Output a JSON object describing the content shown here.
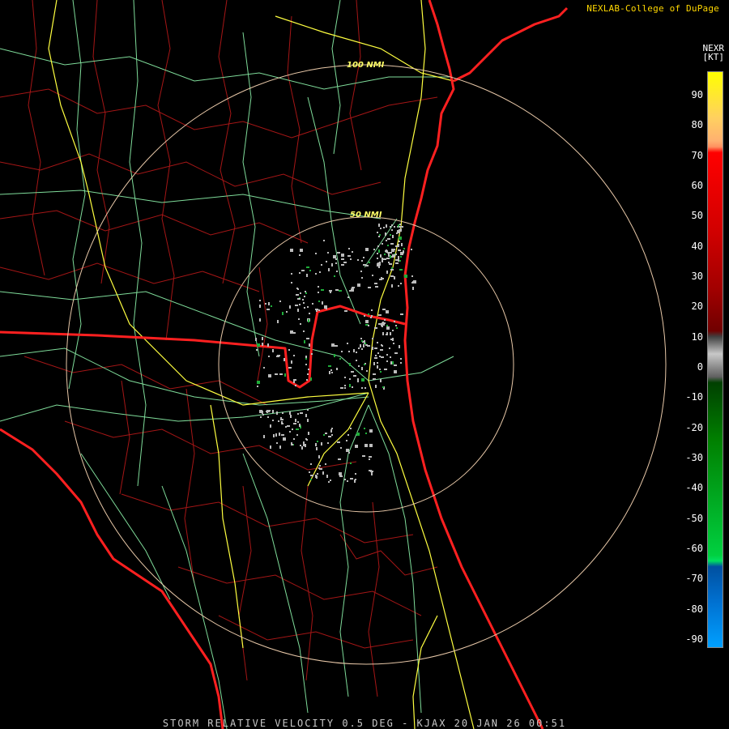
{
  "credit": "NEXLAB-College of DuPage",
  "legend": {
    "product": "NEXR",
    "unit": "[KT]",
    "ticks": [
      "90",
      "80",
      "70",
      "60",
      "50",
      "40",
      "30",
      "20",
      "10",
      "0",
      "-10",
      "-20",
      "-30",
      "-40",
      "-50",
      "-60",
      "-70",
      "-80",
      "-90"
    ]
  },
  "rings": {
    "inner": "50 NMI",
    "outer": "100 NMI"
  },
  "footer": "STORM RELATIVE VELOCITY 0.5 DEG - KJAX 20 JAN 26 00:51",
  "colors": {
    "state_lines": "#ff2020",
    "county_lines": "#b01818",
    "highways": "#ffff40",
    "roads": "#7fdc9a",
    "range_rings": "#e8c8a8",
    "echo_gray": "#bdbdbd",
    "echo_green": "#1fae3a"
  }
}
